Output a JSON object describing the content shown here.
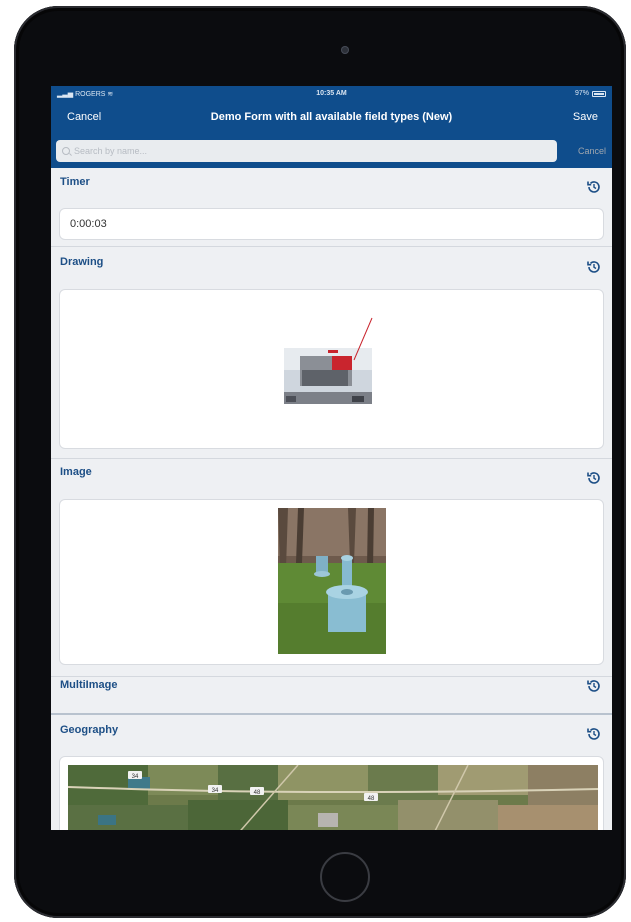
{
  "status_bar": {
    "carrier": "ROGERS",
    "time": "10:35 AM",
    "battery": "97%"
  },
  "nav": {
    "cancel_label": "Cancel",
    "title": "Demo Form with all available field types (New)",
    "save_label": "Save"
  },
  "search": {
    "placeholder": "Search by name...",
    "cancel_label": "Cancel"
  },
  "fields": {
    "timer": {
      "label": "Timer",
      "value": "0:00:03"
    },
    "drawing": {
      "label": "Drawing"
    },
    "image": {
      "label": "Image"
    },
    "multiimage": {
      "label": "MultiImage"
    },
    "geography": {
      "label": "Geography",
      "map_labels": [
        "34",
        "34",
        "48",
        "48"
      ]
    }
  },
  "icons": {
    "reset": "history-icon",
    "search": "search-icon"
  },
  "colors": {
    "nav_blue": "#0f4d8c",
    "label_blue": "#1d4f86",
    "screen_bg": "#eef0f3"
  }
}
